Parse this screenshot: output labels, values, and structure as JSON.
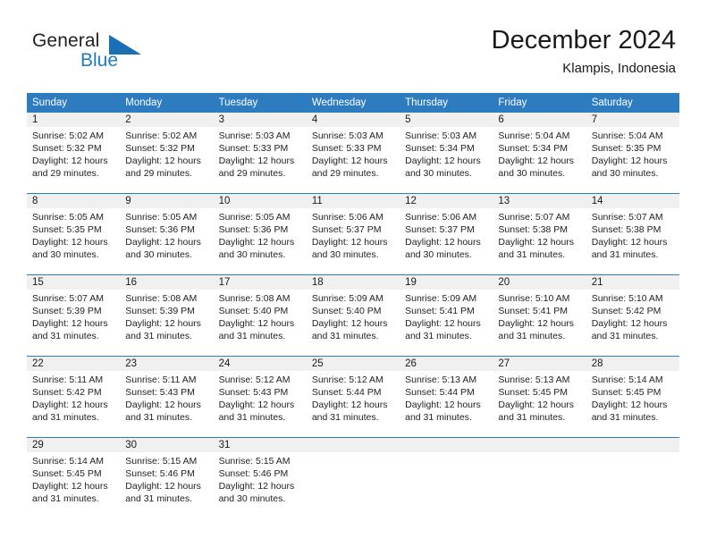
{
  "brand": {
    "name_part1": "General",
    "name_part2": "Blue",
    "logo_icon": "blue-triangle-icon",
    "accent_color": "#1a6fb5"
  },
  "header": {
    "title": "December 2024",
    "subtitle": "Klampis, Indonesia"
  },
  "colors": {
    "header_row_bg": "#2e7cc0",
    "daynum_band_bg": "#f0f0f0",
    "week_separator": "#2e7cc0",
    "text": "#222222"
  },
  "weekday_headers": [
    "Sunday",
    "Monday",
    "Tuesday",
    "Wednesday",
    "Thursday",
    "Friday",
    "Saturday"
  ],
  "weeks": [
    [
      {
        "day": "1",
        "sunrise": "Sunrise: 5:02 AM",
        "sunset": "Sunset: 5:32 PM",
        "daylight": "Daylight: 12 hours and 29 minutes."
      },
      {
        "day": "2",
        "sunrise": "Sunrise: 5:02 AM",
        "sunset": "Sunset: 5:32 PM",
        "daylight": "Daylight: 12 hours and 29 minutes."
      },
      {
        "day": "3",
        "sunrise": "Sunrise: 5:03 AM",
        "sunset": "Sunset: 5:33 PM",
        "daylight": "Daylight: 12 hours and 29 minutes."
      },
      {
        "day": "4",
        "sunrise": "Sunrise: 5:03 AM",
        "sunset": "Sunset: 5:33 PM",
        "daylight": "Daylight: 12 hours and 29 minutes."
      },
      {
        "day": "5",
        "sunrise": "Sunrise: 5:03 AM",
        "sunset": "Sunset: 5:34 PM",
        "daylight": "Daylight: 12 hours and 30 minutes."
      },
      {
        "day": "6",
        "sunrise": "Sunrise: 5:04 AM",
        "sunset": "Sunset: 5:34 PM",
        "daylight": "Daylight: 12 hours and 30 minutes."
      },
      {
        "day": "7",
        "sunrise": "Sunrise: 5:04 AM",
        "sunset": "Sunset: 5:35 PM",
        "daylight": "Daylight: 12 hours and 30 minutes."
      }
    ],
    [
      {
        "day": "8",
        "sunrise": "Sunrise: 5:05 AM",
        "sunset": "Sunset: 5:35 PM",
        "daylight": "Daylight: 12 hours and 30 minutes."
      },
      {
        "day": "9",
        "sunrise": "Sunrise: 5:05 AM",
        "sunset": "Sunset: 5:36 PM",
        "daylight": "Daylight: 12 hours and 30 minutes."
      },
      {
        "day": "10",
        "sunrise": "Sunrise: 5:05 AM",
        "sunset": "Sunset: 5:36 PM",
        "daylight": "Daylight: 12 hours and 30 minutes."
      },
      {
        "day": "11",
        "sunrise": "Sunrise: 5:06 AM",
        "sunset": "Sunset: 5:37 PM",
        "daylight": "Daylight: 12 hours and 30 minutes."
      },
      {
        "day": "12",
        "sunrise": "Sunrise: 5:06 AM",
        "sunset": "Sunset: 5:37 PM",
        "daylight": "Daylight: 12 hours and 30 minutes."
      },
      {
        "day": "13",
        "sunrise": "Sunrise: 5:07 AM",
        "sunset": "Sunset: 5:38 PM",
        "daylight": "Daylight: 12 hours and 31 minutes."
      },
      {
        "day": "14",
        "sunrise": "Sunrise: 5:07 AM",
        "sunset": "Sunset: 5:38 PM",
        "daylight": "Daylight: 12 hours and 31 minutes."
      }
    ],
    [
      {
        "day": "15",
        "sunrise": "Sunrise: 5:07 AM",
        "sunset": "Sunset: 5:39 PM",
        "daylight": "Daylight: 12 hours and 31 minutes."
      },
      {
        "day": "16",
        "sunrise": "Sunrise: 5:08 AM",
        "sunset": "Sunset: 5:39 PM",
        "daylight": "Daylight: 12 hours and 31 minutes."
      },
      {
        "day": "17",
        "sunrise": "Sunrise: 5:08 AM",
        "sunset": "Sunset: 5:40 PM",
        "daylight": "Daylight: 12 hours and 31 minutes."
      },
      {
        "day": "18",
        "sunrise": "Sunrise: 5:09 AM",
        "sunset": "Sunset: 5:40 PM",
        "daylight": "Daylight: 12 hours and 31 minutes."
      },
      {
        "day": "19",
        "sunrise": "Sunrise: 5:09 AM",
        "sunset": "Sunset: 5:41 PM",
        "daylight": "Daylight: 12 hours and 31 minutes."
      },
      {
        "day": "20",
        "sunrise": "Sunrise: 5:10 AM",
        "sunset": "Sunset: 5:41 PM",
        "daylight": "Daylight: 12 hours and 31 minutes."
      },
      {
        "day": "21",
        "sunrise": "Sunrise: 5:10 AM",
        "sunset": "Sunset: 5:42 PM",
        "daylight": "Daylight: 12 hours and 31 minutes."
      }
    ],
    [
      {
        "day": "22",
        "sunrise": "Sunrise: 5:11 AM",
        "sunset": "Sunset: 5:42 PM",
        "daylight": "Daylight: 12 hours and 31 minutes."
      },
      {
        "day": "23",
        "sunrise": "Sunrise: 5:11 AM",
        "sunset": "Sunset: 5:43 PM",
        "daylight": "Daylight: 12 hours and 31 minutes."
      },
      {
        "day": "24",
        "sunrise": "Sunrise: 5:12 AM",
        "sunset": "Sunset: 5:43 PM",
        "daylight": "Daylight: 12 hours and 31 minutes."
      },
      {
        "day": "25",
        "sunrise": "Sunrise: 5:12 AM",
        "sunset": "Sunset: 5:44 PM",
        "daylight": "Daylight: 12 hours and 31 minutes."
      },
      {
        "day": "26",
        "sunrise": "Sunrise: 5:13 AM",
        "sunset": "Sunset: 5:44 PM",
        "daylight": "Daylight: 12 hours and 31 minutes."
      },
      {
        "day": "27",
        "sunrise": "Sunrise: 5:13 AM",
        "sunset": "Sunset: 5:45 PM",
        "daylight": "Daylight: 12 hours and 31 minutes."
      },
      {
        "day": "28",
        "sunrise": "Sunrise: 5:14 AM",
        "sunset": "Sunset: 5:45 PM",
        "daylight": "Daylight: 12 hours and 31 minutes."
      }
    ],
    [
      {
        "day": "29",
        "sunrise": "Sunrise: 5:14 AM",
        "sunset": "Sunset: 5:45 PM",
        "daylight": "Daylight: 12 hours and 31 minutes."
      },
      {
        "day": "30",
        "sunrise": "Sunrise: 5:15 AM",
        "sunset": "Sunset: 5:46 PM",
        "daylight": "Daylight: 12 hours and 31 minutes."
      },
      {
        "day": "31",
        "sunrise": "Sunrise: 5:15 AM",
        "sunset": "Sunset: 5:46 PM",
        "daylight": "Daylight: 12 hours and 30 minutes."
      },
      {
        "day": "",
        "sunrise": "",
        "sunset": "",
        "daylight": ""
      },
      {
        "day": "",
        "sunrise": "",
        "sunset": "",
        "daylight": ""
      },
      {
        "day": "",
        "sunrise": "",
        "sunset": "",
        "daylight": ""
      },
      {
        "day": "",
        "sunrise": "",
        "sunset": "",
        "daylight": ""
      }
    ]
  ]
}
